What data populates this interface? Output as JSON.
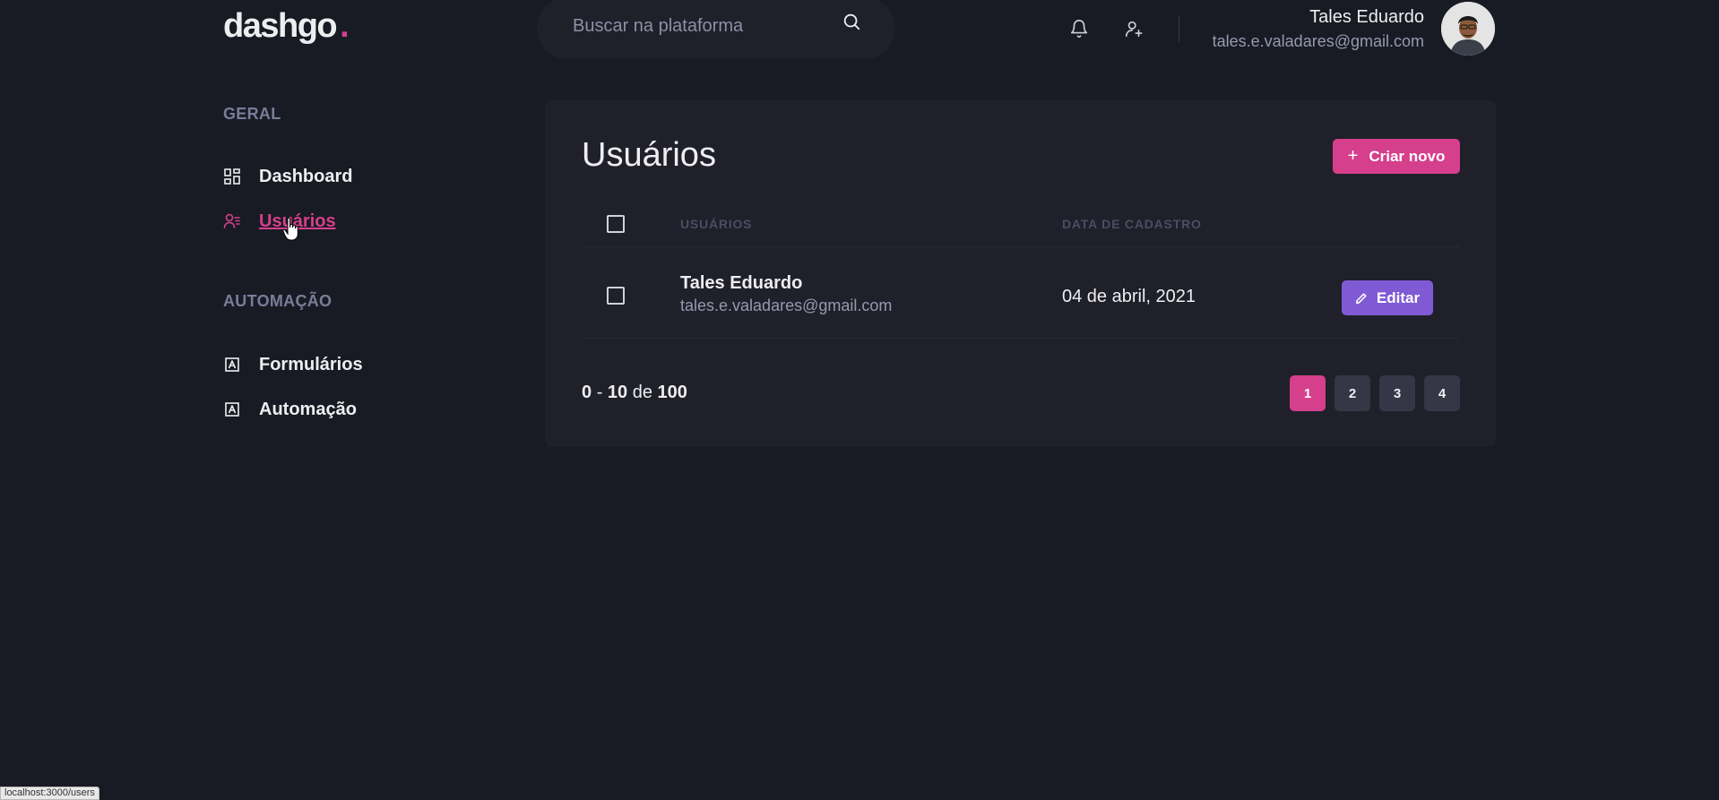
{
  "logo": {
    "text": "dashgo",
    "dot": "."
  },
  "search": {
    "placeholder": "Buscar na plataforma"
  },
  "profile": {
    "name": "Tales Eduardo",
    "email": "tales.e.valadares@gmail.com"
  },
  "sidebar": {
    "sections": [
      {
        "title": "GERAL",
        "items": [
          {
            "label": "Dashboard",
            "icon": "dashboard-icon",
            "active": false
          },
          {
            "label": "Usuários",
            "icon": "users-icon",
            "active": true
          }
        ]
      },
      {
        "title": "AUTOMAÇÃO",
        "items": [
          {
            "label": "Formulários",
            "icon": "form-icon",
            "active": false
          },
          {
            "label": "Automação",
            "icon": "automation-icon",
            "active": false
          }
        ]
      }
    ]
  },
  "main": {
    "title": "Usuários",
    "create_label": "Criar novo",
    "table": {
      "headers": {
        "users": "USUÁRIOS",
        "date": "DATA DE CADASTRO"
      },
      "rows": [
        {
          "name": "Tales Eduardo",
          "email": "tales.e.valadares@gmail.com",
          "date": "04 de abril, 2021",
          "edit_label": "Editar"
        }
      ]
    },
    "pagination": {
      "from": "0",
      "separator": "-",
      "to": "10",
      "of_word": "de",
      "total": "100",
      "pages": [
        "1",
        "2",
        "3",
        "4"
      ],
      "current": "1"
    }
  },
  "status_bar": {
    "url": "localhost:3000/users"
  },
  "colors": {
    "background": "#181b23",
    "panel": "#1f2029",
    "accent": "#d53f8c",
    "edit": "#805ad5",
    "page_button": "#353646"
  }
}
